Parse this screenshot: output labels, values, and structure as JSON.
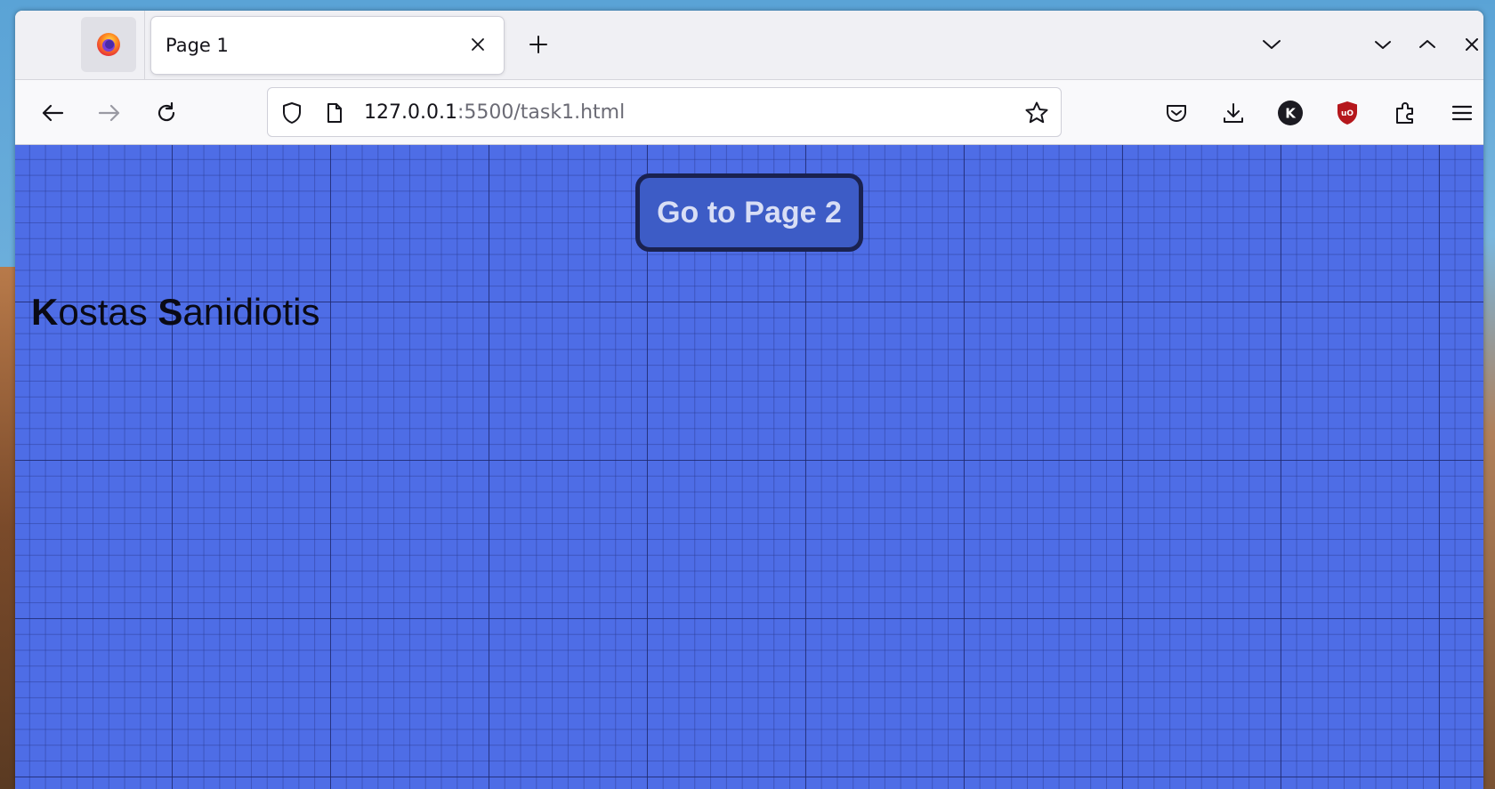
{
  "browser": {
    "tab": {
      "title": "Page 1"
    },
    "url": {
      "host": "127.0.0.1",
      "rest": ":5500/task1.html"
    },
    "account_initial": "K",
    "ublock_label": "uO"
  },
  "page": {
    "button_label": "Go to Page 2",
    "author": {
      "first_initial": "K",
      "first_rest": "ostas ",
      "last_initial": "S",
      "last_rest": "anidiotis"
    }
  },
  "colors": {
    "page_background": "#4e6de6",
    "button_background": "#3d5cc6",
    "button_border": "#1a2250",
    "ublock_red": "#b5171c"
  }
}
